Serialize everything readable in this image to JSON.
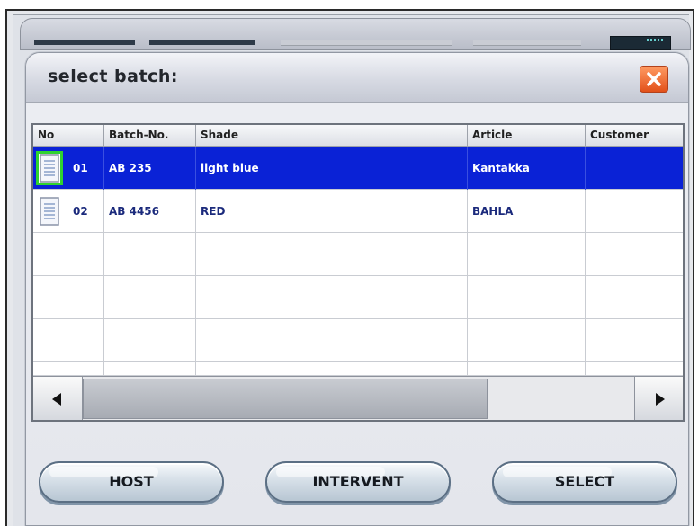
{
  "dialog": {
    "title": "select batch:",
    "close_icon": "close-x-icon"
  },
  "table": {
    "columns": [
      "No",
      "Batch-No.",
      "Shade",
      "Article",
      "Customer"
    ],
    "rows": [
      {
        "no": "01",
        "batch_no": "AB 235",
        "shade": "light blue",
        "article": "Kantakka",
        "customer": "",
        "selected": true
      },
      {
        "no": "02",
        "batch_no": "AB 4456",
        "shade": "RED",
        "article": "BAHLA",
        "customer": "",
        "selected": false
      }
    ],
    "selection_color": "#0a22d6"
  },
  "buttons": {
    "host": "HOST",
    "intervent": "INTERVENT",
    "select": "SELECT"
  },
  "icons": {
    "row_icon": "document-icon",
    "scroll_left": "triangle-left-icon",
    "scroll_right": "triangle-right-icon"
  }
}
